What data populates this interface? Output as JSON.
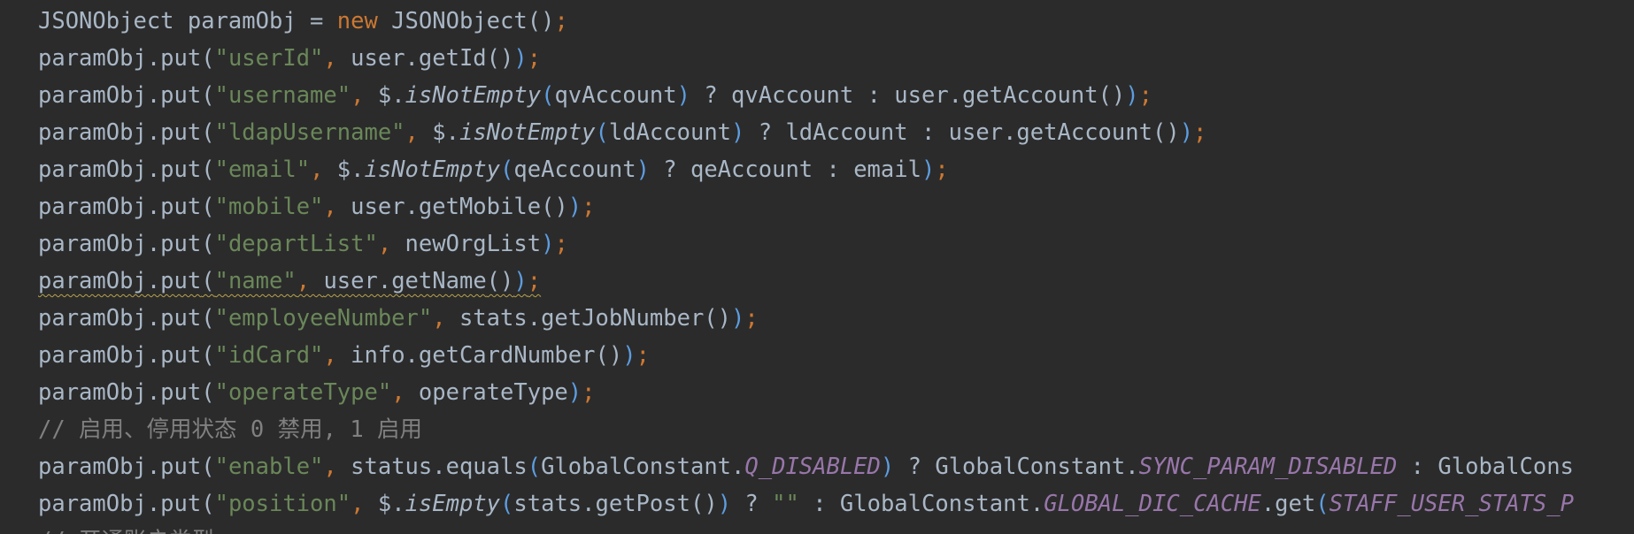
{
  "editor": {
    "lines": [
      {
        "tokens": [
          {
            "t": "JSONObject paramObj = ",
            "k": "default"
          },
          {
            "t": "new",
            "k": "keyword"
          },
          {
            "t": " JSONObject",
            "k": "default"
          },
          {
            "t": "()",
            "k": "paren1"
          },
          {
            "t": ";",
            "k": "punct"
          }
        ]
      },
      {
        "tokens": [
          {
            "t": "paramObj.put",
            "k": "default"
          },
          {
            "t": "(",
            "k": "paren1"
          },
          {
            "t": "\"userId\"",
            "k": "string"
          },
          {
            "t": ", ",
            "k": "punct"
          },
          {
            "t": "user.getId",
            "k": "default"
          },
          {
            "t": "()",
            "k": "paren1"
          },
          {
            "t": ")",
            "k": "paren2"
          },
          {
            "t": ";",
            "k": "punct"
          }
        ]
      },
      {
        "tokens": [
          {
            "t": "paramObj.put",
            "k": "default"
          },
          {
            "t": "(",
            "k": "paren1"
          },
          {
            "t": "\"username\"",
            "k": "string"
          },
          {
            "t": ", ",
            "k": "punct"
          },
          {
            "t": "$.",
            "k": "default"
          },
          {
            "t": "isNotEmpty",
            "k": "method-static"
          },
          {
            "t": "(",
            "k": "paren2"
          },
          {
            "t": "qvAccount",
            "k": "default"
          },
          {
            "t": ")",
            "k": "paren2"
          },
          {
            "t": " ? qvAccount : user.getAccount",
            "k": "default"
          },
          {
            "t": "()",
            "k": "paren1"
          },
          {
            "t": ")",
            "k": "paren2"
          },
          {
            "t": ";",
            "k": "punct"
          }
        ]
      },
      {
        "tokens": [
          {
            "t": "paramObj.put",
            "k": "default"
          },
          {
            "t": "(",
            "k": "paren1"
          },
          {
            "t": "\"ldapUsername\"",
            "k": "string"
          },
          {
            "t": ", ",
            "k": "punct"
          },
          {
            "t": "$.",
            "k": "default"
          },
          {
            "t": "isNotEmpty",
            "k": "method-static"
          },
          {
            "t": "(",
            "k": "paren2"
          },
          {
            "t": "ldAccount",
            "k": "default"
          },
          {
            "t": ")",
            "k": "paren2"
          },
          {
            "t": " ? ldAccount : user.getAccount",
            "k": "default"
          },
          {
            "t": "()",
            "k": "paren1"
          },
          {
            "t": ")",
            "k": "paren2"
          },
          {
            "t": ";",
            "k": "punct"
          }
        ]
      },
      {
        "tokens": [
          {
            "t": "paramObj.put",
            "k": "default"
          },
          {
            "t": "(",
            "k": "paren1"
          },
          {
            "t": "\"email\"",
            "k": "string"
          },
          {
            "t": ", ",
            "k": "punct"
          },
          {
            "t": "$.",
            "k": "default"
          },
          {
            "t": "isNotEmpty",
            "k": "method-static"
          },
          {
            "t": "(",
            "k": "paren2"
          },
          {
            "t": "qeAccount",
            "k": "default"
          },
          {
            "t": ")",
            "k": "paren2"
          },
          {
            "t": " ? qeAccount : email",
            "k": "default"
          },
          {
            "t": ")",
            "k": "paren2"
          },
          {
            "t": ";",
            "k": "punct"
          }
        ]
      },
      {
        "tokens": [
          {
            "t": "paramObj.put",
            "k": "default"
          },
          {
            "t": "(",
            "k": "paren1"
          },
          {
            "t": "\"mobile\"",
            "k": "string"
          },
          {
            "t": ", ",
            "k": "punct"
          },
          {
            "t": "user.getMobile",
            "k": "default"
          },
          {
            "t": "()",
            "k": "paren1"
          },
          {
            "t": ")",
            "k": "paren2"
          },
          {
            "t": ";",
            "k": "punct"
          }
        ]
      },
      {
        "tokens": [
          {
            "t": "paramObj.put",
            "k": "default"
          },
          {
            "t": "(",
            "k": "paren1"
          },
          {
            "t": "\"departList\"",
            "k": "string"
          },
          {
            "t": ", ",
            "k": "punct"
          },
          {
            "t": "newOrgList",
            "k": "default"
          },
          {
            "t": ")",
            "k": "paren2"
          },
          {
            "t": ";",
            "k": "punct"
          }
        ]
      },
      {
        "squiggle": true,
        "tokens": [
          {
            "t": "paramObj.put",
            "k": "default"
          },
          {
            "t": "(",
            "k": "paren1"
          },
          {
            "t": "\"name\"",
            "k": "string"
          },
          {
            "t": ", ",
            "k": "punct"
          },
          {
            "t": "user.getName",
            "k": "default"
          },
          {
            "t": "()",
            "k": "paren1"
          },
          {
            "t": ")",
            "k": "paren2"
          },
          {
            "t": ";",
            "k": "punct"
          }
        ]
      },
      {
        "tokens": [
          {
            "t": "paramObj.put",
            "k": "default"
          },
          {
            "t": "(",
            "k": "paren1"
          },
          {
            "t": "\"employeeNumber\"",
            "k": "string"
          },
          {
            "t": ", ",
            "k": "punct"
          },
          {
            "t": "stats.getJobNumber",
            "k": "default"
          },
          {
            "t": "()",
            "k": "paren1"
          },
          {
            "t": ")",
            "k": "paren2"
          },
          {
            "t": ";",
            "k": "punct"
          }
        ]
      },
      {
        "tokens": [
          {
            "t": "paramObj.put",
            "k": "default"
          },
          {
            "t": "(",
            "k": "paren1"
          },
          {
            "t": "\"idCard\"",
            "k": "string"
          },
          {
            "t": ", ",
            "k": "punct"
          },
          {
            "t": "info.getCardNumber",
            "k": "default"
          },
          {
            "t": "()",
            "k": "paren1"
          },
          {
            "t": ")",
            "k": "paren2"
          },
          {
            "t": ";",
            "k": "punct"
          }
        ]
      },
      {
        "tokens": [
          {
            "t": "paramObj.put",
            "k": "default"
          },
          {
            "t": "(",
            "k": "paren1"
          },
          {
            "t": "\"operateType\"",
            "k": "string"
          },
          {
            "t": ", ",
            "k": "punct"
          },
          {
            "t": "operateType",
            "k": "default"
          },
          {
            "t": ")",
            "k": "paren2"
          },
          {
            "t": ";",
            "k": "punct"
          }
        ]
      },
      {
        "tokens": [
          {
            "t": "// 启用、停用状态 0 禁用, 1 启用",
            "k": "comment"
          }
        ]
      },
      {
        "tokens": [
          {
            "t": "paramObj.put",
            "k": "default"
          },
          {
            "t": "(",
            "k": "paren1"
          },
          {
            "t": "\"enable\"",
            "k": "string"
          },
          {
            "t": ", ",
            "k": "punct"
          },
          {
            "t": "status.equals",
            "k": "default"
          },
          {
            "t": "(",
            "k": "paren2"
          },
          {
            "t": "GlobalConstant.",
            "k": "default"
          },
          {
            "t": "Q_DISABLED",
            "k": "const"
          },
          {
            "t": ")",
            "k": "paren2"
          },
          {
            "t": " ? GlobalConstant.",
            "k": "default"
          },
          {
            "t": "SYNC_PARAM_DISABLED",
            "k": "const"
          },
          {
            "t": " : GlobalCons",
            "k": "default"
          }
        ]
      },
      {
        "tokens": [
          {
            "t": "paramObj.put",
            "k": "default"
          },
          {
            "t": "(",
            "k": "paren1"
          },
          {
            "t": "\"position\"",
            "k": "string"
          },
          {
            "t": ", ",
            "k": "punct"
          },
          {
            "t": "$.",
            "k": "default"
          },
          {
            "t": "isEmpty",
            "k": "method-static"
          },
          {
            "t": "(",
            "k": "paren2"
          },
          {
            "t": "stats.getPost",
            "k": "default"
          },
          {
            "t": "()",
            "k": "paren1"
          },
          {
            "t": ")",
            "k": "paren2"
          },
          {
            "t": " ? ",
            "k": "default"
          },
          {
            "t": "\"\"",
            "k": "string"
          },
          {
            "t": " : GlobalConstant.",
            "k": "default"
          },
          {
            "t": "GLOBAL_DIC_CACHE",
            "k": "const"
          },
          {
            "t": ".get",
            "k": "default"
          },
          {
            "t": "(",
            "k": "paren2"
          },
          {
            "t": "STAFF_USER_STATS_P",
            "k": "const"
          }
        ]
      },
      {
        "tokens": [
          {
            "t": "// 开通账户类型",
            "k": "comment"
          }
        ]
      }
    ]
  }
}
